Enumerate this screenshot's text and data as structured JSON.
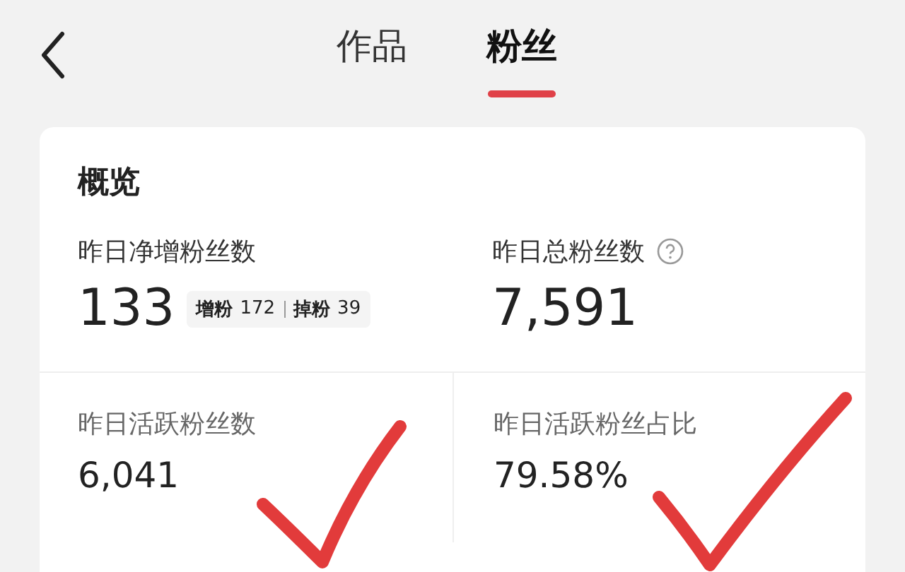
{
  "tabs": [
    {
      "label": "作品",
      "selected": false
    },
    {
      "label": "粉丝",
      "selected": true
    }
  ],
  "overview": {
    "title": "概览",
    "stats": [
      {
        "label": "昨日净增粉丝数",
        "value": "133",
        "help": false,
        "breakdown": [
          {
            "label": "增粉",
            "value": "172"
          },
          {
            "label": "掉粉",
            "value": "39"
          }
        ]
      },
      {
        "label": "昨日总粉丝数",
        "value": "7,591",
        "help": true
      }
    ],
    "active": [
      {
        "label": "昨日活跃粉丝数",
        "value": "6,041"
      },
      {
        "label": "昨日活跃粉丝占比",
        "value": "79.58%"
      }
    ]
  }
}
